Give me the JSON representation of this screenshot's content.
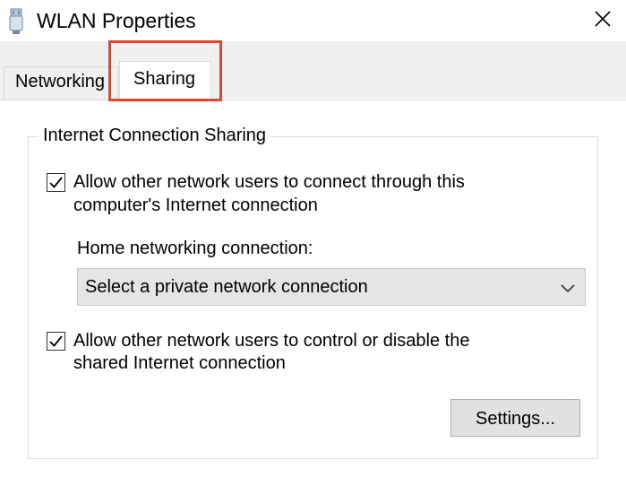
{
  "window": {
    "title": "WLAN Properties",
    "icon": "network-adapter-icon",
    "close_icon": "close-icon"
  },
  "tabs": [
    {
      "label": "Networking",
      "selected": false
    },
    {
      "label": "Sharing",
      "selected": true
    }
  ],
  "highlight_color": "#e8412c",
  "group": {
    "title": "Internet Connection Sharing",
    "allow_connect": {
      "checked": true,
      "line1": "Allow other network users to connect through this",
      "line2": "computer's Internet connection"
    },
    "home_label": "Home networking connection:",
    "home_select": {
      "value": "Select a private network connection",
      "icon": "chevron-down-icon"
    },
    "allow_control": {
      "checked": true,
      "line1": "Allow other network users to control or disable the",
      "line2": "shared Internet connection"
    },
    "settings_label": "Settings..."
  }
}
